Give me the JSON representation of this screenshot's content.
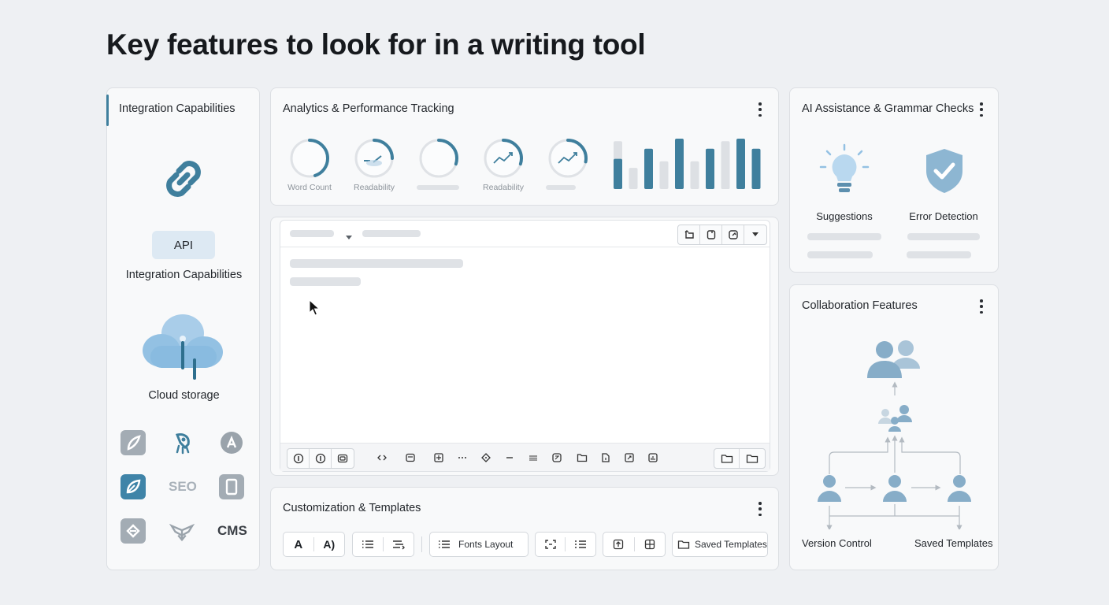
{
  "page": {
    "title": "Key features to look for in a writing tool"
  },
  "integration": {
    "title": "Integration Capabilities",
    "api_label": "API",
    "caption": "Integration Capabilities",
    "cloud_label": "Cloud storage",
    "seo_label": "SEO",
    "cms_label": "CMS"
  },
  "analytics": {
    "title": "Analytics & Performance Tracking",
    "gauges": [
      {
        "label": "Word Count",
        "value": 0.45
      },
      {
        "label": "Readability",
        "value": 0.25
      },
      {
        "label": "",
        "value": 0.3
      },
      {
        "label": "Readability",
        "value": 0.3
      },
      {
        "label": "",
        "value": 0.28
      }
    ],
    "bars": [
      {
        "value": 0.6,
        "light": 0.95
      },
      {
        "value": 0.42,
        "light": 0
      },
      {
        "value": 0.8,
        "light": 0
      },
      {
        "value": 0.55,
        "light": 0
      },
      {
        "value": 1.0,
        "light": 0
      },
      {
        "value": 0.55,
        "light": 0
      },
      {
        "value": 0.8,
        "light": 0
      },
      {
        "value": 0.82,
        "light": 0.95
      },
      {
        "value": 1.0,
        "light": 0
      },
      {
        "value": 0.8,
        "light": 0
      }
    ],
    "colors": {
      "accent": "#3f7f9d",
      "muted": "#dde0e4"
    }
  },
  "editor": {
    "toolbar_bottom_icons": [
      "info-icon",
      "info-icon",
      "image-icon",
      "code-icon",
      "comment-icon",
      "plus-icon",
      "ellipsis-icon",
      "diamond-icon",
      "minus-icon",
      "align-icon",
      "frame-icon",
      "folder-icon",
      "file-icon",
      "link-icon",
      "chart-icon",
      "folder-icon",
      "folder-icon"
    ]
  },
  "customization": {
    "title": "Customization & Templates",
    "font_a": "A",
    "font_a2": "A)",
    "fonts_layout": "Fonts Layout",
    "saved_templates": "Saved Templates"
  },
  "ai": {
    "title": "AI Assistance & Grammar Checks",
    "suggestions": "Suggestions",
    "error_detection": "Error Detection"
  },
  "collab": {
    "title": "Collaboration Features",
    "version_control": "Version Control",
    "saved_templates": "Saved Templates"
  }
}
